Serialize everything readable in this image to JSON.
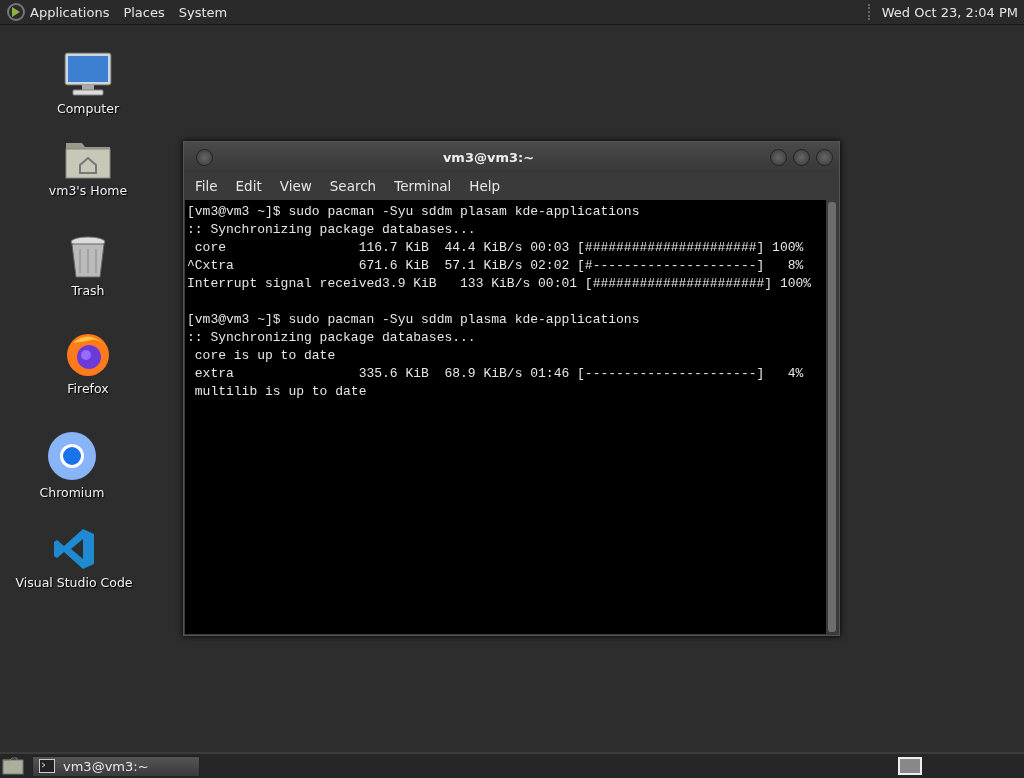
{
  "top_panel": {
    "menus": [
      "Applications",
      "Places",
      "System"
    ],
    "clock": "Wed Oct 23,  2:04 PM"
  },
  "desktop_icons": [
    {
      "kind": "computer",
      "label": "Computer"
    },
    {
      "kind": "home",
      "label": "vm3's Home"
    },
    {
      "kind": "trash",
      "label": "Trash"
    },
    {
      "kind": "firefox",
      "label": "Firefox"
    },
    {
      "kind": "chromium",
      "label": "Chromium"
    },
    {
      "kind": "vscode",
      "label": "Visual Studio Code"
    }
  ],
  "terminal_window": {
    "title": "vm3@vm3:~",
    "menu": [
      "File",
      "Edit",
      "View",
      "Search",
      "Terminal",
      "Help"
    ],
    "output_blocks": [
      [
        "[vm3@vm3 ~]$ sudo pacman -Syu sddm plasam kde-applications",
        ":: Synchronizing package databases...",
        " core                 116.7 KiB  44.4 KiB/s 00:03 [######################] 100%",
        "^Cxtra                671.6 KiB  57.1 KiB/s 02:02 [#---------------------]   8%",
        "Interrupt signal received3.9 KiB   133 KiB/s 00:01 [######################] 100%"
      ],
      [
        "[vm3@vm3 ~]$ sudo pacman -Syu sddm plasma kde-applications",
        ":: Synchronizing package databases...",
        " core is up to date",
        " extra                335.6 KiB  68.9 KiB/s 01:46 [----------------------]   4%",
        " multilib is up to date"
      ]
    ]
  },
  "taskbar": {
    "tasks": [
      {
        "label": "vm3@vm3:~"
      }
    ]
  }
}
